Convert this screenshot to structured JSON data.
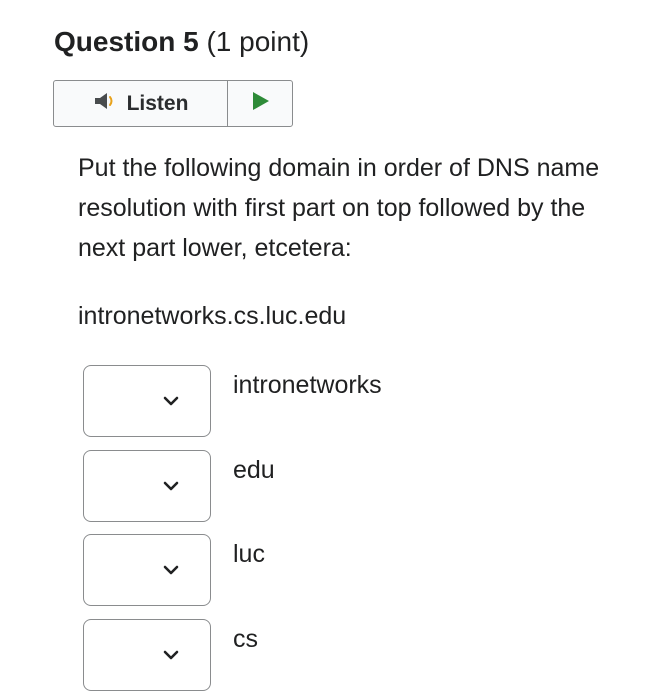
{
  "question": {
    "title": "Question 5",
    "points": "(1 point)"
  },
  "listen": {
    "label": "Listen",
    "speaker_icon": "speaker-icon",
    "play_icon": "play-icon",
    "play_color": "#2e8b38"
  },
  "prompt": {
    "text": "Put the following domain in order of DNS name resolution with first part on top followed by the next part lower, etcetera:",
    "domain": "intronetworks.cs.luc.edu"
  },
  "order_items": [
    {
      "label": "intronetworks",
      "selected": ""
    },
    {
      "label": "edu",
      "selected": ""
    },
    {
      "label": "luc",
      "selected": ""
    },
    {
      "label": "cs",
      "selected": ""
    }
  ]
}
